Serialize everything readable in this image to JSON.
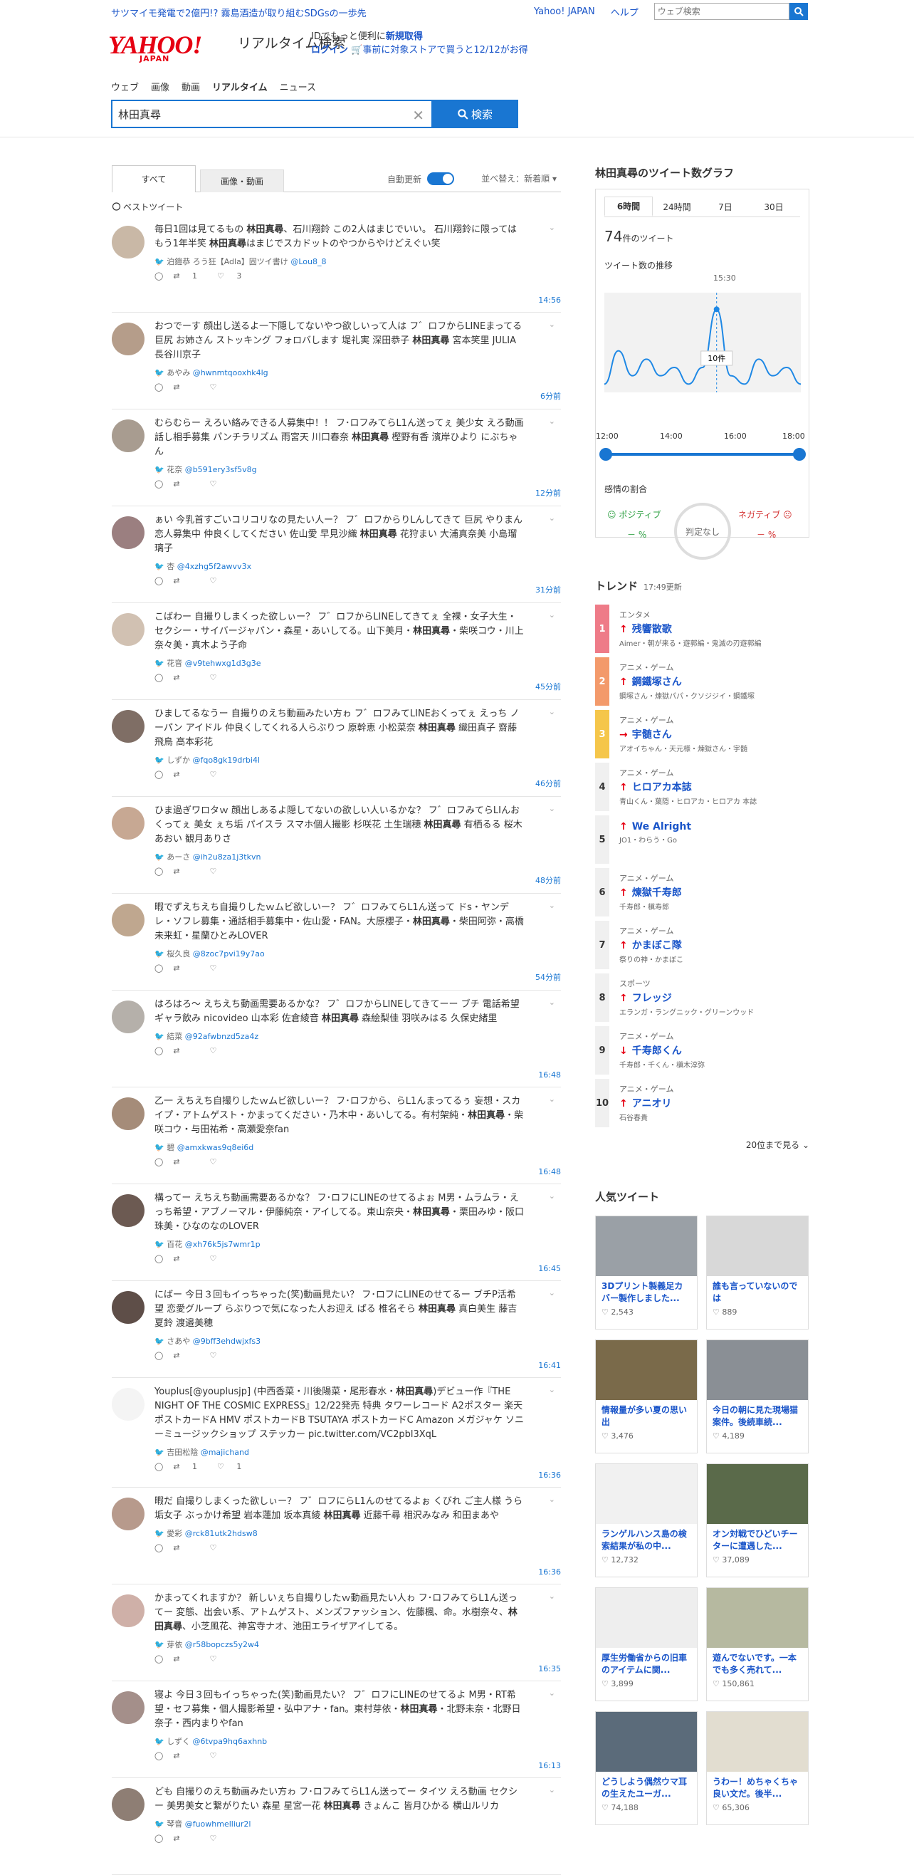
{
  "topbar": {
    "ad_text": "サツマイモ発電で2億円!? 霧島酒造が取り組むSDGsの一歩先",
    "yahoo_japan": "Yahoo! JAPAN",
    "help": "ヘルプ",
    "web_search_placeholder": "ウェブ検索"
  },
  "header": {
    "logo": "YAHOO!",
    "logo_sub": "JAPAN",
    "service_name": "リアルタイム検索",
    "id_line1_prefix": "IDでもっと便利に",
    "id_line1_link": "新規取得",
    "id_line2_login": "ログイン",
    "id_line2_text": "🛒事前に対象ストアで買うと12/12がお得"
  },
  "nav": [
    "ウェブ",
    "画像",
    "動画",
    "リアルタイム",
    "ニュース"
  ],
  "search": {
    "query": "林田真尋",
    "button": "検索"
  },
  "tabs": {
    "all": "すべて",
    "media": "画像・動画",
    "auto_update": "自動更新",
    "sort": "並べ替え：新着順 ▾"
  },
  "best_tweet_label": "ベストツイート",
  "tweets": [
    {
      "text": "毎日1回は見てるもの 林田真尋、石川翔鈴 この2人はまじでいい。 石川翔鈴に限ってはもう1年半笑 林田真尋はまじでスカドットのやつからやけどえぐい笑",
      "user": "泊鎧恭 ろう狂【Adla】固ツイ書け",
      "handle": "@Lou8_8",
      "rt": "1",
      "like": "3",
      "time": "14:56"
    },
    {
      "text": "おつでーす 顔出し送るよ一下隠してないやつ欲しいって人は フ゛ロフからLINEまってる 巨尻 お姉さん ストッキング フォロバします 堤礼実 深田恭子 林田真尋 宮本笑里 JULIA 長谷川京子",
      "user": "あやみ",
      "handle": "@hwnmtqooxhk4lg",
      "rt": "",
      "like": "",
      "time": "6分前"
    },
    {
      "text": "むらむらー えろい絡みできる人募集中！！ フ･ロフみてらL1ん送ってぇ 美少女 えろ動画 話し相手募集 パンチラリズム 雨宮天 川口春奈 林田真尋 樫野有香 濱岸ひより にぶちゃん",
      "user": "花奈",
      "handle": "@b591ery3sf5v8g",
      "rt": "",
      "like": "",
      "time": "12分前"
    },
    {
      "text": "ぁい 今乳首すごいコリコリなの見たい人ー？ フ゛ロフからりLんしてきて 巨尻 やりまん 恋人募集中 仲良くしてください 佐山愛 早見沙織 林田真尋 花狩まい 大浦真奈美 小島瑠璃子",
      "user": "杏",
      "handle": "@4xzhg5f2awvv3x",
      "rt": "",
      "like": "",
      "time": "31分前"
    },
    {
      "text": "こばわー 自撮りしまくった欲しぃー？ フ゛ロフからLINEしてきてぇ 全裸・女子大生・セクシー・サイバージャパン・森星・あいしてる。山下美月・林田真尋・柴咲コウ・川上奈々美・真木よう子命",
      "user": "花音",
      "handle": "@v9tehwxg1d3g3e",
      "rt": "",
      "like": "",
      "time": "45分前"
    },
    {
      "text": "ひましてるなうー 自撮りのえち動画みたい方ゎ フ゛ロフみてLINEおくってぇ えっち ノーパン アイドル 仲良くしてくれる人らぶりつ 原幹恵 小松菜奈 林田真尋 織田真子 齋藤飛鳥 高本彩花",
      "user": "しずか",
      "handle": "@fqo8gk19drbi4l",
      "rt": "",
      "like": "",
      "time": "46分前"
    },
    {
      "text": "ひま過ぎワロタｗ 顔出しあるよ隠してないの欲しい人いるかな？ フ゛ロフみてらLIんおくってぇ 美女 ぇち垢 パイスラ スマホ個人撮影 杉咲花 土生瑞穂 林田真尋 有栖るる 桜木あおい 観月ありさ",
      "user": "あーさ",
      "handle": "@ih2u8za1j3tkvn",
      "rt": "",
      "like": "",
      "time": "48分前"
    },
    {
      "text": "暇でずえちえち自撮りしたｗムビ欲しいー？ フ゛ロフみてらL1ん送って ドs・ヤンデレ・ソフレ募集・通話相手募集中・佐山愛・FAN。大原櫻子・林田真尋・柴田阿弥・高橋未来虹・星蘭ひとみLOVER",
      "user": "桜久良",
      "handle": "@8zoc7pvi19y7ao",
      "rt": "",
      "like": "",
      "time": "54分前"
    },
    {
      "text": "はろはろ～ えちえち動画需要あるかな？ フ゛ロフからLINEしてきてーー ブチ 電話希望 ギャラ飲み nicovideo 山本彩 佐倉綾音 林田真尋 森絵梨佳 羽咲みはる 久保史緒里",
      "user": "結菜",
      "handle": "@92afwbnzd5za4z",
      "rt": "",
      "like": "",
      "time": "16:48"
    },
    {
      "text": "乙一 えちえち自撮りしたｗムビ欲しいー？ フ･ロフから、らL1んまってるぅ 妄想・スカイプ・アトムゲスト・かまってください・乃木中・あいしてる。有村架純・林田真尋・柴咲コウ・与田祐希・高瀬愛奈fan",
      "user": "碧",
      "handle": "@amxkwas9q8ei6d",
      "rt": "",
      "like": "",
      "time": "16:48"
    },
    {
      "text": "構ってー えちえち動画需要あるかな？ フ･ロフにLINEのせてるよぉ M男・ムラムラ・えっち希望・アブノーマル・伊藤純奈・アイしてる。東山奈央・林田真尋・栗田みゆ・阪口珠美・ひなのなのLOVER",
      "user": "百花",
      "handle": "@xh76k5js7wmr1p",
      "rt": "",
      "like": "",
      "time": "16:45"
    },
    {
      "text": "にばー 今日３回もイっちゃった(笑)動画見たい？ フ･ロフにLINEのせてるー ブチP活希望 恋愛グループ らぶりつで気になった人お迎え ぱる 椎名そら 林田真尋 真白美生 藤吉夏鈴 渡邉美穂",
      "user": "さあや",
      "handle": "@9bff3ehdwjxfs3",
      "rt": "",
      "like": "",
      "time": "16:41"
    },
    {
      "text": "Youplus[@youplusjp] (中西香菜・川後陽菜・尾形春水・林田真尋)デビュー作『THE NIGHT OF THE COSMIC EXPRESS』12/22発売 特典 タワーレコード A2ポスター 楽天 ポストカードA HMV ポストカードB TSUTAYA ポストカードC Amazon メガジャケ ソニーミュージックショップ ステッカー pic.twitter.com/VC2pbl3XqL",
      "user": "吉田松陰",
      "handle": "@majichand",
      "rt": "1",
      "like": "1",
      "time": "16:36"
    },
    {
      "text": "暇だ 自撮りしまくった欲しぃー？ フ゛ロフにらL1んのせてるよぉ くびれ ご主人様 うら垢女子 ぶっかけ希望 岩本蓮加 坂本真綾 林田真尋 近藤千尋 相沢みなみ 和田まあや",
      "user": "愛彩",
      "handle": "@rck81utk2hdsw8",
      "rt": "",
      "like": "",
      "time": "16:36"
    },
    {
      "text": "かまってくれますか？ 新しいぇち自撮りしたｗ動画見たい人ゎ フ･ロフみてらL1ん送ってー 変態、出会い系、アトムゲスト、メンズファッション、佐藤楓、命。水樹奈々、林田真尋、小芝風花、神宮寺ナオ、池田エライザアイしてる。",
      "user": "芽依",
      "handle": "@r58bopczs5y2w4",
      "rt": "",
      "like": "",
      "time": "16:35"
    },
    {
      "text": "寝よ 今日３回もイっちゃった(笑)動画見たい？ フ゛ロフにLINEのせてるよ M男・RT希望・セフ募集・個人撮影希望・弘中アナ・fan。東村芽依・林田真尋・北野未奈・北野日奈子・西内まりやfan",
      "user": "しずく",
      "handle": "@6tvpa9hq6axhnb",
      "rt": "",
      "like": "",
      "time": "16:13"
    },
    {
      "text": "ども 自撮りのえち動画みたい方ゎ フ･ロフみてらL1ん送ってー タイツ えろ動画 セクシー 美男美女と繋がりたい 森星 星宮一花 林田真尋 きょんこ 皆月ひかる 横山ルリカ",
      "user": "琴音",
      "handle": "@fuowhmelliur2l",
      "rt": "",
      "like": "",
      "time": ""
    }
  ],
  "graph": {
    "title": "林田真尋のツイート数グラフ",
    "tabs": [
      "6時間",
      "24時間",
      "7日",
      "30日"
    ],
    "count": "74",
    "count_unit": "件のツイート",
    "sub": "ツイート数の推移",
    "peak_time": "15:30",
    "peak_label": "10件",
    "hours": [
      "12:00",
      "14:00",
      "16:00",
      "18:00"
    ],
    "emotion_title": "感情の割合",
    "positive": "ポジティブ",
    "negative": "ネガティブ",
    "neutral": "判定なし",
    "pos_value": "－",
    "neg_value": "－",
    "pct": "%"
  },
  "chart_data": {
    "type": "area",
    "x": [
      "12:00",
      "12:30",
      "13:00",
      "13:30",
      "14:00",
      "14:30",
      "15:00",
      "15:15",
      "15:30",
      "15:45",
      "16:00",
      "16:30",
      "17:00",
      "17:30",
      "18:00"
    ],
    "values": [
      1,
      5,
      2,
      4,
      2,
      3,
      1,
      3,
      10,
      2,
      1,
      4,
      2,
      3,
      1
    ]
  },
  "trend": {
    "title": "トレンド",
    "updated": "17:49更新",
    "items": [
      {
        "rank": "1",
        "cat": "エンタメ",
        "word": "残響散歌",
        "words": "Aimer・朝が来る・遊郭編・鬼滅の刃遊郭編",
        "color": "#ee7b88",
        "arrow": "↑"
      },
      {
        "rank": "2",
        "cat": "アニメ・ゲーム",
        "word": "鋼鐵塚さん",
        "words": "鋼塚さん・煉獄パパ・クソジジイ・鋼鐵塚",
        "color": "#f39a6b",
        "arrow": "↑"
      },
      {
        "rank": "3",
        "cat": "アニメ・ゲーム",
        "word": "宇髄さん",
        "words": "アオイちゃん・天元様・煉獄さん・宇髄",
        "color": "#f5c64a",
        "arrow": "→"
      },
      {
        "rank": "4",
        "cat": "アニメ・ゲーム",
        "word": "ヒロアカ本誌",
        "words": "青山くん・葉隠・ヒロアカ・ヒロアカ 本誌",
        "color": "",
        "arrow": "↑"
      },
      {
        "rank": "5",
        "cat": "",
        "word": "We Alright",
        "words": "JO1・わらう・Go",
        "color": "",
        "arrow": "↑"
      },
      {
        "rank": "6",
        "cat": "アニメ・ゲーム",
        "word": "煉獄千寿郎",
        "words": "千寿郎・槇寿郎",
        "color": "",
        "arrow": "↑"
      },
      {
        "rank": "7",
        "cat": "アニメ・ゲーム",
        "word": "かまぼこ隊",
        "words": "祭りの神・かまぼこ",
        "color": "",
        "arrow": "↑"
      },
      {
        "rank": "8",
        "cat": "スポーツ",
        "word": "フレッジ",
        "words": "エランガ・ラングニック・グリーンウッド",
        "color": "",
        "arrow": "↑"
      },
      {
        "rank": "9",
        "cat": "アニメ・ゲーム",
        "word": "千寿郎くん",
        "words": "千寿郎・千くん・槇木淳弥",
        "color": "",
        "arrow": "↓"
      },
      {
        "rank": "10",
        "cat": "アニメ・ゲーム",
        "word": "アニオリ",
        "words": "石谷春貴",
        "color": "",
        "arrow": "↑"
      }
    ],
    "more": "20位まで見る ⌄"
  },
  "popular": {
    "title": "人気ツイート",
    "cards": [
      {
        "title": "3Dプリント製義足カバー製作しました...",
        "likes": "2,543",
        "bg": "#9aa0a6"
      },
      {
        "title": "誰も言っていないのでは",
        "likes": "889",
        "bg": "#d8d8d8"
      },
      {
        "title": "情報量が多い夏の思い出",
        "likes": "3,476",
        "bg": "#7a6a4a"
      },
      {
        "title": "今日の朝に見た現場猫案件。後続車続...",
        "likes": "4,189",
        "bg": "#8a8f95"
      },
      {
        "title": "ランゲルハンス島の検索結果が私の中...",
        "likes": "12,732",
        "bg": "#f1f1f1"
      },
      {
        "title": "オン対戦でひどいチーターに遭遇した...",
        "likes": "37,089",
        "bg": "#5a6a4a"
      },
      {
        "title": "厚生労働省からの旧車のアイテムに関...",
        "likes": "3,899",
        "bg": "#eeeeee"
      },
      {
        "title": "遊んでないです。一本でも多く売れて...",
        "likes": "150,861",
        "bg": "#b6b9a0"
      },
      {
        "title": "どうしよう偶然ウマ耳の生えたユーガ...",
        "likes": "74,188",
        "bg": "#5b6b7a"
      },
      {
        "title": "うわー！めちゃくちゃ良い文だ。後半...",
        "likes": "65,306",
        "bg": "#e2ddd0"
      }
    ]
  }
}
